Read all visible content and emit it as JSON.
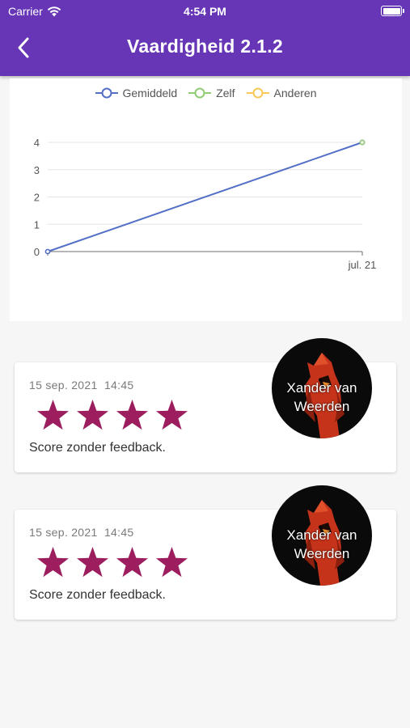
{
  "status_bar": {
    "carrier": "Carrier",
    "time": "4:54 PM"
  },
  "header": {
    "title": "Vaardigheid 2.1.2"
  },
  "colors": {
    "header_bg": "#6736b6",
    "gemiddeld": "#5470c6",
    "zelf": "#91cc75",
    "anderen": "#fac858",
    "star": "#9c1e5e"
  },
  "chart_data": {
    "type": "line",
    "legend": [
      "Gemiddeld",
      "Zelf",
      "Anderen"
    ],
    "legend_position": "top-center",
    "categories": [
      "",
      "jul. 21"
    ],
    "series": [
      {
        "name": "Gemiddeld",
        "values": [
          0,
          4
        ]
      },
      {
        "name": "Zelf",
        "values": [
          null,
          4
        ]
      },
      {
        "name": "Anderen",
        "values": []
      }
    ],
    "y_ticks": [
      "0",
      "1",
      "2",
      "3",
      "4"
    ],
    "ylim": [
      0,
      4
    ],
    "grid": true
  },
  "feedback": [
    {
      "date": "15 sep. 2021",
      "time": "14:45",
      "stars": 4,
      "text": "Score zonder feedback.",
      "author": "Xander van Weerden"
    },
    {
      "date": "15 sep. 2021",
      "time": "14:45",
      "stars": 4,
      "text": "Score zonder feedback.",
      "author": "Xander van Weerden"
    }
  ]
}
